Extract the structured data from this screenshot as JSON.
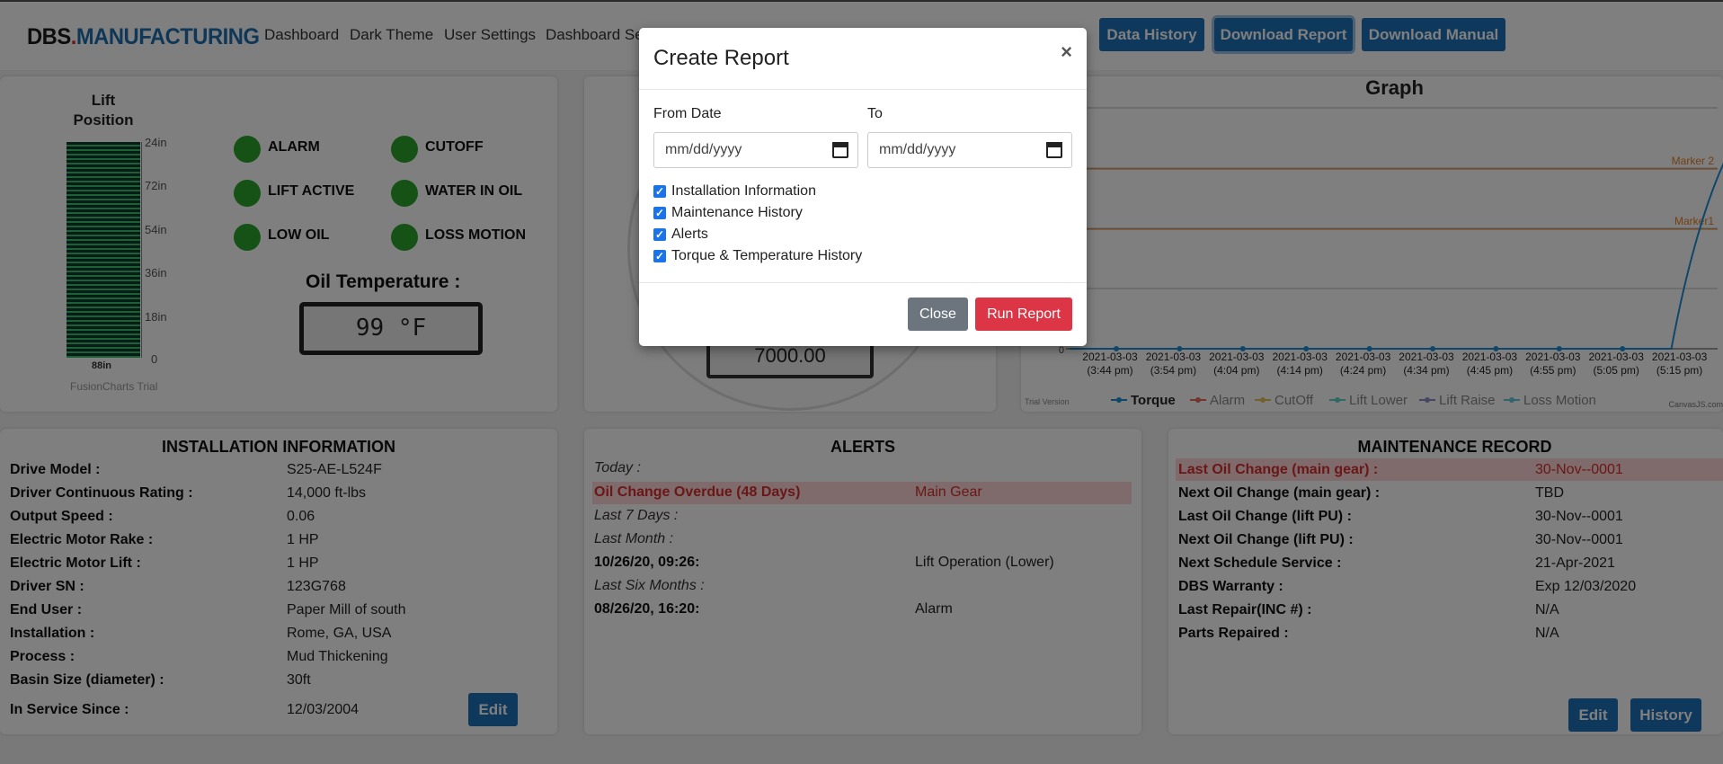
{
  "header": {
    "logo_a": "DBS",
    "logo_dot": ".",
    "logo_b": "MANUFACTURING",
    "links": [
      "Dashboard",
      "Dark Theme",
      "User Settings",
      "Dashboard Se"
    ],
    "buttons": [
      "Data History",
      "Download Report",
      "Download Manual"
    ]
  },
  "lift": {
    "title1": "Lift",
    "title2": "Position",
    "ticks": [
      "24in",
      "72in",
      "54in",
      "36in",
      "18in",
      "0"
    ],
    "bottom": "88in",
    "watermark": "FusionCharts Trial"
  },
  "status": {
    "labels": [
      "ALARM",
      "CUTOFF",
      "LIFT ACTIVE",
      "WATER IN OIL",
      "LOW OIL",
      "LOSS MOTION"
    ]
  },
  "oil": {
    "label": "Oil Temperature :",
    "value": "99 °F"
  },
  "gauge": {
    "value": "7000.00"
  },
  "graph": {
    "title": "Graph",
    "markers": [
      "Marker 2",
      "Marker1"
    ],
    "trial": "Trial Version",
    "credit": "CanvasJS.com",
    "zero": "0"
  },
  "chart_data": {
    "type": "line",
    "title": "Graph",
    "x": [
      "2021-03-03 (3:44 pm)",
      "2021-03-03 (3:54 pm)",
      "2021-03-03 (4:04 pm)",
      "2021-03-03 (4:14 pm)",
      "2021-03-03 (4:24 pm)",
      "2021-03-03 (4:34 pm)",
      "2021-03-03 (4:45 pm)",
      "2021-03-03 (4:55 pm)",
      "2021-03-03 (5:05 pm)",
      "2021-03-03 (5:15 pm)"
    ],
    "x_lines": [
      [
        "2021-03-03",
        "(3:44 pm)"
      ],
      [
        "2021-03-03",
        "(3:54 pm)"
      ],
      [
        "2021-03-03",
        "(4:04 pm)"
      ],
      [
        "2021-03-03",
        "(4:14 pm)"
      ],
      [
        "2021-03-03",
        "(4:24 pm)"
      ],
      [
        "2021-03-03",
        "(4:34 pm)"
      ],
      [
        "2021-03-03",
        "(4:45 pm)"
      ],
      [
        "2021-03-03",
        "(4:55 pm)"
      ],
      [
        "2021-03-03",
        "(5:05 pm)"
      ],
      [
        "2021-03-03",
        "(5:15 pm)"
      ]
    ],
    "series": [
      {
        "name": "Torque",
        "values": [
          0,
          0,
          0,
          0,
          0,
          0,
          0,
          0,
          0,
          100
        ]
      }
    ],
    "legend": [
      "Torque",
      "Alarm",
      "CutOff",
      "Lift Lower",
      "Lift Raise",
      "Loss Motion"
    ],
    "legend_colors": [
      "#1f8fd6",
      "#e56b5d",
      "#e2c55a",
      "#5fd3c6",
      "#8f8fc5",
      "#67c6d9"
    ],
    "line_color": "#1f8fd6"
  },
  "install": {
    "title": "INSTALLATION INFORMATION",
    "rows": [
      [
        "Drive Model :",
        "S25-AE-L524F"
      ],
      [
        "Driver Continuous Rating :",
        "14,000 ft-lbs"
      ],
      [
        "Output Speed :",
        "0.06"
      ],
      [
        "Electric Motor Rake :",
        "1 HP"
      ],
      [
        "Electric Motor Lift :",
        "1 HP"
      ],
      [
        "Driver SN :",
        "123G768"
      ],
      [
        "End User :",
        "Paper Mill of south"
      ],
      [
        "Installation :",
        "Rome, GA, USA"
      ],
      [
        "Process :",
        "Mud Thickening"
      ],
      [
        "Basin Size (diameter) :",
        "30ft"
      ],
      [
        "In Service Since :",
        "12/03/2004"
      ]
    ],
    "edit": "Edit"
  },
  "alerts": {
    "title": "ALERTS",
    "today": "Today :",
    "overdue": "Oil Change Overdue (48 Days)",
    "overdue_val": "Main Gear",
    "last7": "Last 7 Days :",
    "lastmonth": "Last Month :",
    "e1": "10/26/20, 09:26:",
    "e1v": "Lift Operation (Lower)",
    "last6": "Last Six Months :",
    "e2": "08/26/20, 16:20:",
    "e2v": "Alarm"
  },
  "maint": {
    "title": "MAINTENANCE RECORD",
    "rows": [
      [
        "Last Oil Change (main gear) :",
        "30-Nov--0001"
      ],
      [
        "Next Oil Change (main gear) :",
        "TBD"
      ],
      [
        "Last Oil Change (lift PU) :",
        "30-Nov--0001"
      ],
      [
        "Next Oil Change (lift PU) :",
        "30-Nov--0001"
      ],
      [
        "Next Schedule Service :",
        "21-Apr-2021"
      ],
      [
        "DBS Warranty :",
        "Exp 12/03/2020"
      ],
      [
        "Last Repair(INC #) :",
        "N/A"
      ],
      [
        "Parts Repaired :",
        "N/A"
      ]
    ],
    "edit": "Edit",
    "history": "History"
  },
  "modal": {
    "title": "Create Report",
    "close_x": "×",
    "from_label": "From Date",
    "to_label": "To",
    "placeholder": "mm/dd/yyyy",
    "options": [
      "Installation Information",
      "Maintenance History",
      "Alerts",
      "Torque & Temperature History"
    ],
    "close": "Close",
    "run": "Run Report"
  }
}
